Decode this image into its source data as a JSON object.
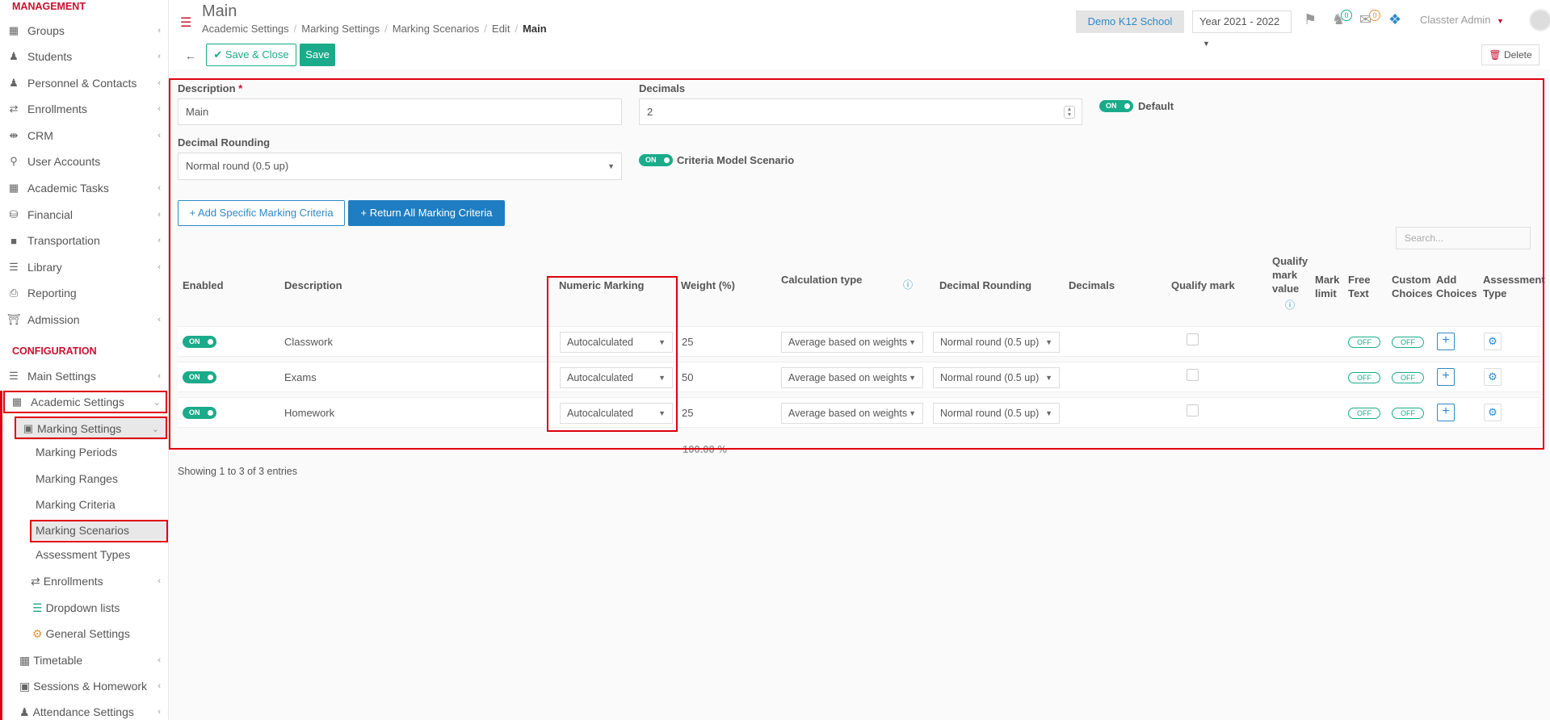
{
  "sidebar": {
    "management_title": "MANAGEMENT",
    "configuration_title": "CONFIGURATION",
    "management_items": [
      {
        "label": "Groups",
        "icon": "groups-icon"
      },
      {
        "label": "Students",
        "icon": "students-icon"
      },
      {
        "label": "Personnel & Contacts",
        "icon": "person-icon"
      },
      {
        "label": "Enrollments",
        "icon": "exchange-icon"
      },
      {
        "label": "CRM",
        "icon": "shuffle-icon"
      },
      {
        "label": "User Accounts",
        "icon": "key-icon"
      },
      {
        "label": "Academic Tasks",
        "icon": "grid-icon"
      },
      {
        "label": "Financial",
        "icon": "coins-icon"
      },
      {
        "label": "Transportation",
        "icon": "bus-icon"
      },
      {
        "label": "Library",
        "icon": "books-icon"
      },
      {
        "label": "Reporting",
        "icon": "print-icon"
      },
      {
        "label": "Admission",
        "icon": "bank-icon"
      }
    ],
    "config_items": {
      "main_settings": "Main Settings",
      "academic_settings": "Academic Settings",
      "marking_settings": "Marking Settings",
      "marking_periods": "Marking Periods",
      "marking_ranges": "Marking Ranges",
      "marking_criteria": "Marking Criteria",
      "marking_scenarios": "Marking Scenarios",
      "assessment_types": "Assessment Types",
      "enrollments": "Enrollments",
      "dropdown_lists": "Dropdown lists",
      "general_settings": "General Settings",
      "timetable": "Timetable",
      "sessions_homework": "Sessions & Homework",
      "attendance_settings": "Attendance Settings"
    }
  },
  "header": {
    "title": "Main",
    "breadcrumb": [
      "Academic Settings",
      "Marking Settings",
      "Marking Scenarios",
      "Edit",
      "Main"
    ],
    "school": "Demo K12 School",
    "year": "Year 2021 - 2022",
    "notif_count": "0",
    "mail_count": "0",
    "user": "Classter Admin"
  },
  "toolbar": {
    "save_close": "Save & Close",
    "save": "Save",
    "delete": "Delete"
  },
  "form": {
    "description_label": "Description",
    "description_required": "*",
    "description_value": "Main",
    "decimals_label": "Decimals",
    "decimals_value": "2",
    "default_label": "Default",
    "toggle_on": "ON",
    "decimal_rounding_label": "Decimal Rounding",
    "decimal_rounding_value": "Normal round (0.5 up)",
    "criteria_model_label": "Criteria Model Scenario"
  },
  "actions": {
    "add_specific": "Add Specific Marking Criteria",
    "return_all": "Return All Marking Criteria",
    "search_placeholder": "Search..."
  },
  "table": {
    "headers": {
      "enabled": "Enabled",
      "description": "Description",
      "numeric_marking": "Numeric Marking",
      "weight": "Weight (%)",
      "calculation_type": "Calculation type",
      "decimal_rounding": "Decimal Rounding",
      "decimals": "Decimals",
      "qualify_mark": "Qualify mark",
      "qualify_mark_value": "Qualify mark value",
      "mark_limit": "Mark limit",
      "free_text": "Free Text",
      "custom_choices": "Custom Choices",
      "add_choices": "Add Choices",
      "assessment_type": "Assessment Type"
    },
    "rows": [
      {
        "enabled": "ON",
        "description": "Classwork",
        "numeric": "Autocalculated",
        "weight": "25",
        "calc": "Average based on weights",
        "rounding": "Normal round (0.5 up)",
        "free_text": "OFF",
        "custom_choices": "OFF"
      },
      {
        "enabled": "ON",
        "description": "Exams",
        "numeric": "Autocalculated",
        "weight": "50",
        "calc": "Average based on weights",
        "rounding": "Normal round (0.5 up)",
        "free_text": "OFF",
        "custom_choices": "OFF"
      },
      {
        "enabled": "ON",
        "description": "Homework",
        "numeric": "Autocalculated",
        "weight": "25",
        "calc": "Average based on weights",
        "rounding": "Normal round (0.5 up)",
        "free_text": "OFF",
        "custom_choices": "OFF"
      }
    ],
    "total_weight": "100.00 %",
    "footer": "Showing 1 to 3 of 3 entries"
  }
}
